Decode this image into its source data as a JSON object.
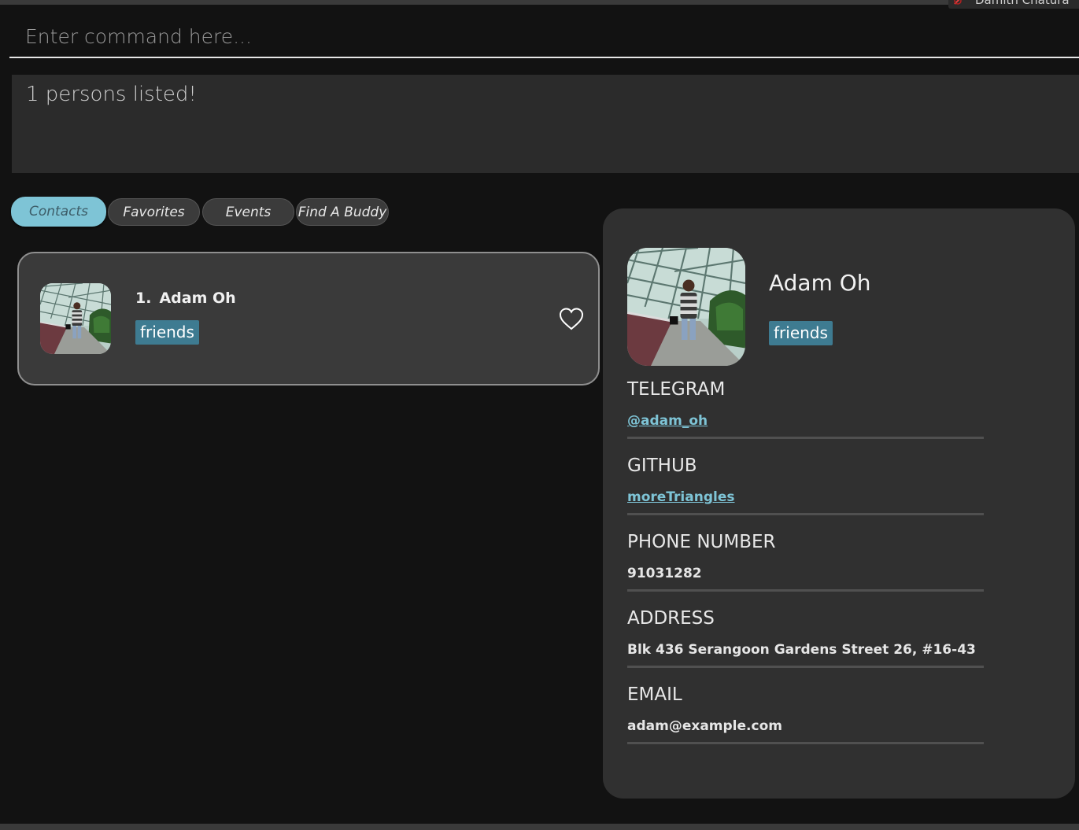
{
  "window": {
    "user_badge": "Damith Chatura"
  },
  "command": {
    "placeholder": "Enter command here..."
  },
  "result": {
    "message": "1 persons listed!"
  },
  "tabs": [
    {
      "label": "Contacts",
      "active": true
    },
    {
      "label": "Favorites",
      "active": false
    },
    {
      "label": "Events",
      "active": false
    },
    {
      "label": "Find A Buddy",
      "active": false
    }
  ],
  "person_list": [
    {
      "index": "1.",
      "name": "Adam Oh",
      "tags": [
        "friends"
      ],
      "favorite_icon": "heart-outline-icon"
    }
  ],
  "details": {
    "name": "Adam Oh",
    "tags": [
      "friends"
    ],
    "fields": [
      {
        "label": "TELEGRAM",
        "value": "@adam_oh",
        "link": true
      },
      {
        "label": "GITHUB",
        "value": "moreTriangles",
        "link": true
      },
      {
        "label": "PHONE NUMBER",
        "value": "91031282",
        "link": false
      },
      {
        "label": "ADDRESS",
        "value": "Blk 436 Serangoon Gardens Street 26, #16-43",
        "link": false
      },
      {
        "label": "EMAIL",
        "value": "adam@example.com",
        "link": false
      }
    ]
  },
  "colors": {
    "accent": "#7ec4d6",
    "tag": "#3e7b91",
    "background": "#121212",
    "panel": "#303030",
    "card": "#3a3a3a"
  }
}
